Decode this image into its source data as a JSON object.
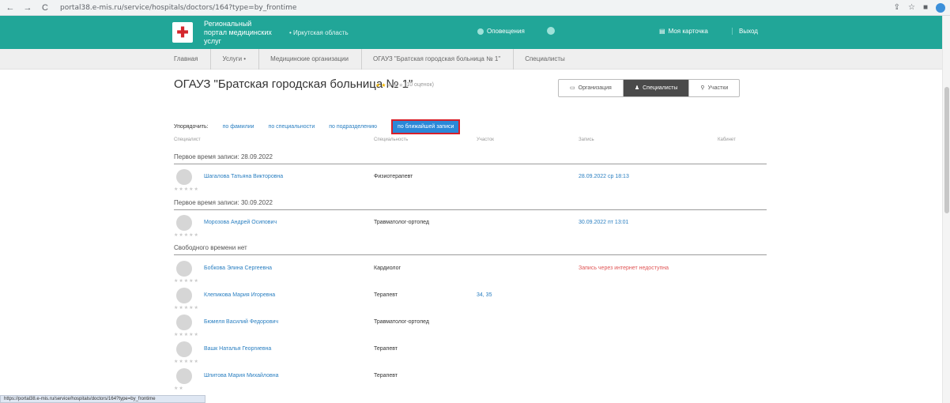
{
  "browser": {
    "url": "portal38.e-mis.ru/service/hospitals/doctors/164?type=by_frontime",
    "back_icon": "←",
    "forward_icon": "→",
    "reload_icon": "C",
    "share_icon": "⇪",
    "star_icon": "☆",
    "window_icon": "■"
  },
  "header": {
    "portal_title": "Региональный портал медицинских услуг",
    "region": "• Иркутская область",
    "notifications": "Оповещения",
    "my_card": "Моя карточка",
    "logout": "Выход"
  },
  "breadcrumb": [
    "Главная",
    "Услуги •",
    "Медицинские организации",
    "ОГАУЗ \"Братская городская больница № 1\"",
    "Специалисты"
  ],
  "hospital": {
    "title": "ОГАУЗ \"Братская городская больница № 1\"",
    "stars": "★★",
    "stars_empty": "★★★",
    "reviews": "(10 оценок)"
  },
  "tabs": [
    {
      "label": "Организация",
      "icon": "▭"
    },
    {
      "label": "Специалисты",
      "icon": "♟"
    },
    {
      "label": "Участки",
      "icon": "⚲"
    }
  ],
  "sort": {
    "label": "Упорядочить:",
    "options": [
      "по фамилии",
      "по специальности",
      "по подразделению"
    ],
    "active": "по ближайшей записи"
  },
  "columns": [
    "Специалист",
    "Специальность",
    "Участок",
    "Запись",
    "Кабинет"
  ],
  "groups": [
    "Первое время записи: 28.09.2022",
    "Первое время записи: 30.09.2022",
    "Свободного времени нет"
  ],
  "doctors": [
    {
      "name": "Шагалова Татьяна Викторовна",
      "spec": "Физиотерапевт",
      "room": "",
      "time": "28.09.2022 ср 18:13",
      "stars": "★★★★★"
    },
    {
      "name": "Морозова Андрей Осипович",
      "spec": "Травматолог-ортопед",
      "room": "",
      "time": "30.09.2022 пт 13:01",
      "stars": "★★★★★"
    },
    {
      "name": "Бобкова Элина Сергеевна",
      "spec": "Кардиолог",
      "room": "",
      "time": "Запись через интернет недоступна",
      "stars": "★★★★★"
    },
    {
      "name": "Клепикова Мария Игоревна",
      "spec": "Терапевт",
      "room": "34, 35",
      "time": "",
      "stars": "★★★★★"
    },
    {
      "name": "Бюмеля Василий Федорович",
      "spec": "Травматолог-ортопед",
      "room": "",
      "time": "",
      "stars": "★★★★★"
    },
    {
      "name": "Вашк Наталья Георгиевна",
      "spec": "Терапевт",
      "room": "",
      "time": "",
      "stars": "★★★★★"
    },
    {
      "name": "Шпитова Мария Михайловна",
      "spec": "Терапевт",
      "room": "",
      "time": "",
      "stars": "★★"
    }
  ],
  "status_url": "https://portal38.e-mis.ru/service/hospitals/doctors/164?type=by_frontime"
}
